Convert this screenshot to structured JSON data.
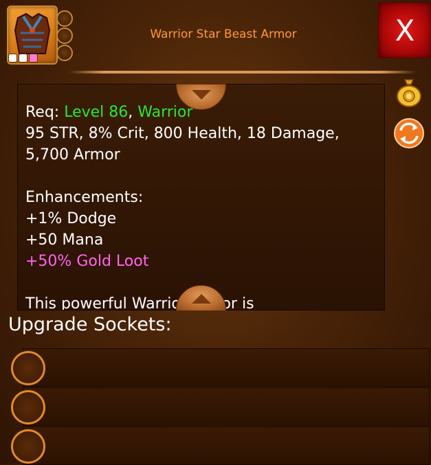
{
  "item": {
    "name": "Warrior Star Beast Armor",
    "stars": [
      "white",
      "white",
      "pink"
    ]
  },
  "close_label": "X",
  "description": {
    "req_label": "Req: ",
    "req_level": "Level 86",
    "req_sep": ", ",
    "req_class": "Warrior",
    "stats_line1": "95 STR, 8% Crit, 800 Health, 18 Damage,",
    "stats_line2": "5,700 Armor",
    "enhancements_header": "Enhancements:",
    "enh_1": "+1% Dodge",
    "enh_2": "+50 Mana",
    "enh_3": "+50% Gold Loot",
    "cut_text": "This powerful Warrior armor is",
    "colors": {
      "req": "#2ce82c",
      "bonus": "#ff66ee",
      "title": "#ff9a3c"
    }
  },
  "side_buttons": {
    "sell": "gold-bag-icon",
    "swap": "swap-arrows-icon"
  },
  "sockets": {
    "title": "Upgrade Sockets:",
    "slots": [
      "empty",
      "empty",
      "empty"
    ]
  }
}
